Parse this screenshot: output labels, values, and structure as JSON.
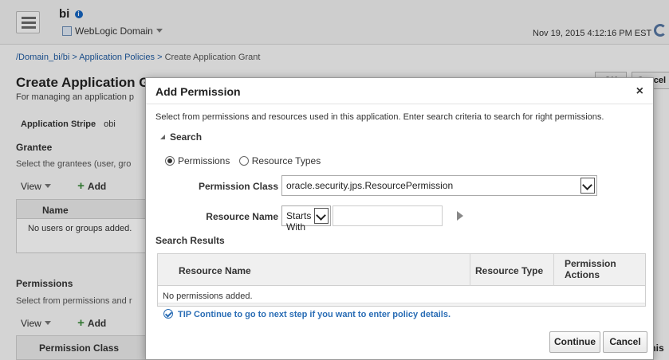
{
  "header": {
    "app_name": "bi",
    "info_badge": "i",
    "domain_menu": "WebLogic Domain",
    "datetime": "Nov 19, 2015 4:12:16 PM EST"
  },
  "breadcrumb": {
    "domain": "/Domain_bi/bi",
    "separator": ">",
    "policies": "Application Policies",
    "current": "Create Application Grant"
  },
  "page": {
    "title": "Create Application Grant",
    "description": "For managing an application p",
    "ok_label": "OK",
    "cancel_label": "Cancel",
    "stripe_label": "Application Stripe",
    "stripe_value": "obi",
    "grantee_heading": "Grantee",
    "grantee_desc": "Select the grantees (user, gro",
    "view_label": "View",
    "add_label": "Add",
    "grid_header": "Name",
    "grid_empty": "No users or groups added.",
    "permissions_heading": "Permissions",
    "permissions_desc": "Select from permissions and r",
    "permission_class_header": "Permission Class",
    "trunc_right": "mis"
  },
  "dialog": {
    "title": "Add Permission",
    "close": "×",
    "description": "Select from permissions and resources used in this application. Enter search criteria to search for right permissions.",
    "search_heading": "Search",
    "radio_permissions": "Permissions",
    "radio_resource_types": "Resource Types",
    "permission_class_label": "Permission Class",
    "permission_class_value": "oracle.security.jps.ResourcePermission",
    "resource_name_label": "Resource Name",
    "resource_operator": "Starts With",
    "resource_value": "",
    "results_heading": "Search Results",
    "results_columns": [
      "Resource Name",
      "Resource Type",
      "Permission Actions"
    ],
    "results_empty": "No permissions added.",
    "tip": "TIP Continue to go to next step if you want to enter policy details.",
    "continue_label": "Continue",
    "cancel_label": "Cancel"
  }
}
